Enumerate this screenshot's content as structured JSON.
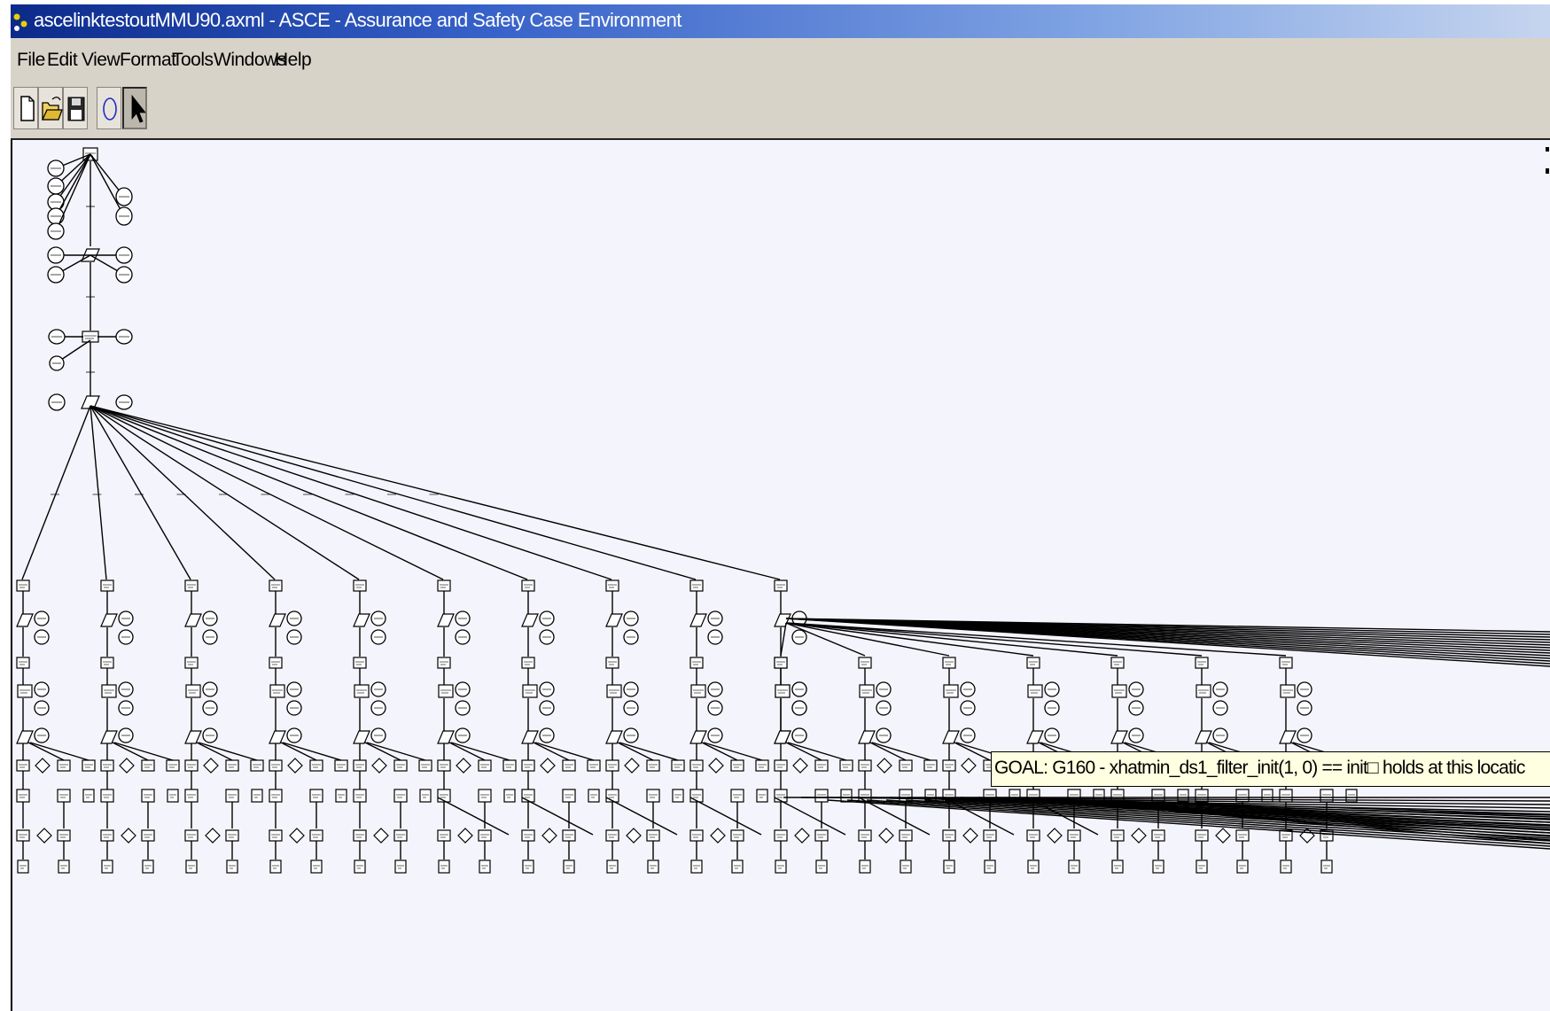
{
  "window": {
    "title": "ascelinktestoutMMU90.axml - ASCE - Assurance and Safety Case Environment",
    "app_icon": "asce-app-icon"
  },
  "menu": {
    "items": [
      "File",
      "Edit",
      "View",
      "Format",
      "Tools",
      "Windows",
      "Help"
    ]
  },
  "toolbar": {
    "buttons": [
      {
        "icon": "new-document-icon"
      },
      {
        "icon": "open-folder-icon"
      },
      {
        "icon": "save-disk-icon"
      },
      {
        "icon": "ellipse-tool-icon"
      },
      {
        "icon": "pointer-arrow-icon",
        "pressed": true
      }
    ]
  },
  "diagram": {
    "upper_branch_columns": 10,
    "lower_branch_columns": 16,
    "colors": {
      "background": "#f4f4fc",
      "line": "#000000"
    }
  },
  "tooltip": {
    "text": "GOAL: G160 - xhatmin_ds1_filter_init(1, 0) == init□ holds at this locatic"
  }
}
